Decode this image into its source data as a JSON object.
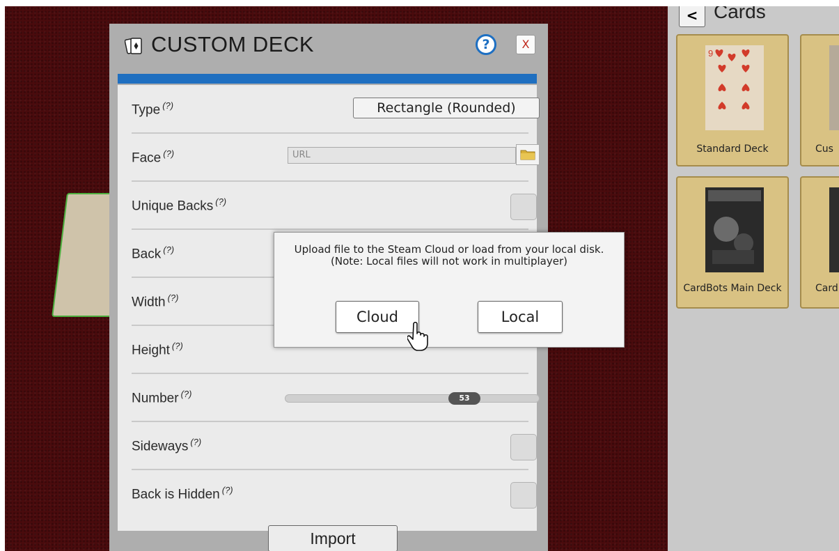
{
  "panel": {
    "title": "CUSTOM DECK",
    "help_glyph": "?",
    "close_glyph": "X",
    "rows": [
      {
        "label": "Type",
        "hint": "(?)",
        "control": "dropdown",
        "value": "Rectangle (Rounded)"
      },
      {
        "label": "Face",
        "hint": "(?)",
        "control": "url",
        "placeholder": "URL"
      },
      {
        "label": "Unique Backs",
        "hint": "(?)",
        "control": "checkbox"
      },
      {
        "label": "Back",
        "hint": "(?)",
        "control": "hidden"
      },
      {
        "label": "Width",
        "hint": "(?)",
        "control": "hidden"
      },
      {
        "label": "Height",
        "hint": "(?)",
        "control": "hidden"
      },
      {
        "label": "Number",
        "hint": "(?)",
        "control": "slider",
        "value": "53"
      },
      {
        "label": "Sideways",
        "hint": "(?)",
        "control": "checkbox"
      },
      {
        "label": "Back is Hidden",
        "hint": "(?)",
        "control": "checkbox"
      }
    ],
    "import_label": "Import"
  },
  "dialog": {
    "message": "Upload file to the Steam Cloud or load from your local disk. (Note: Local files will not work in multiplayer)",
    "cloud_label": "Cloud",
    "local_label": "Local"
  },
  "sidebar": {
    "back_glyph": "<",
    "title": "Cards",
    "tiles": [
      {
        "caption": "Standard Deck"
      },
      {
        "caption": "Cus"
      },
      {
        "caption": "CardBots Main Deck"
      },
      {
        "caption": "Card"
      }
    ]
  },
  "colors": {
    "table_felt": "#4a0b0d",
    "accent_blue": "#1f6fc0",
    "tile_gold": "#d9c283"
  },
  "icons": {
    "title": "card-deck-icon",
    "folder": "folder-icon",
    "cursor": "hand-pointer-icon"
  }
}
